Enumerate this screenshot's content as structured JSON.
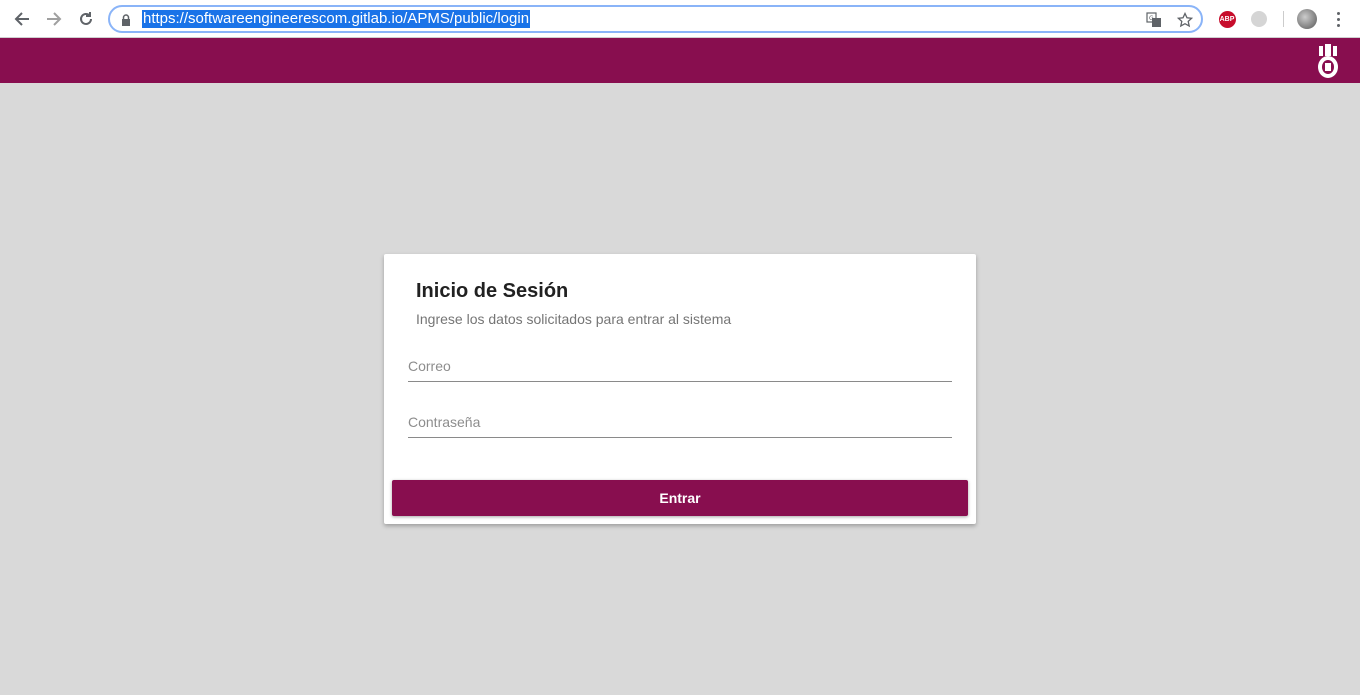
{
  "browser": {
    "url": "https://softwareengineerescom.gitlab.io/APMS/public/login",
    "icons": [
      "back-icon",
      "forward-icon",
      "reload-icon",
      "lock-icon",
      "translate-icon",
      "star-icon",
      "adblock-plus-icon",
      "extension-icon",
      "profile-avatar",
      "menu-icon"
    ],
    "adblock_label": "ABP"
  },
  "header": {
    "color": "#880e4f",
    "logo": "institution-logo"
  },
  "login": {
    "title": "Inicio de Sesión",
    "subtitle": "Ingrese los datos solicitados para entrar al sistema",
    "email_placeholder": "Correo",
    "password_placeholder": "Contraseña",
    "submit_label": "Entrar"
  },
  "colors": {
    "primary": "#880e4f",
    "background": "#d9d9d9"
  }
}
